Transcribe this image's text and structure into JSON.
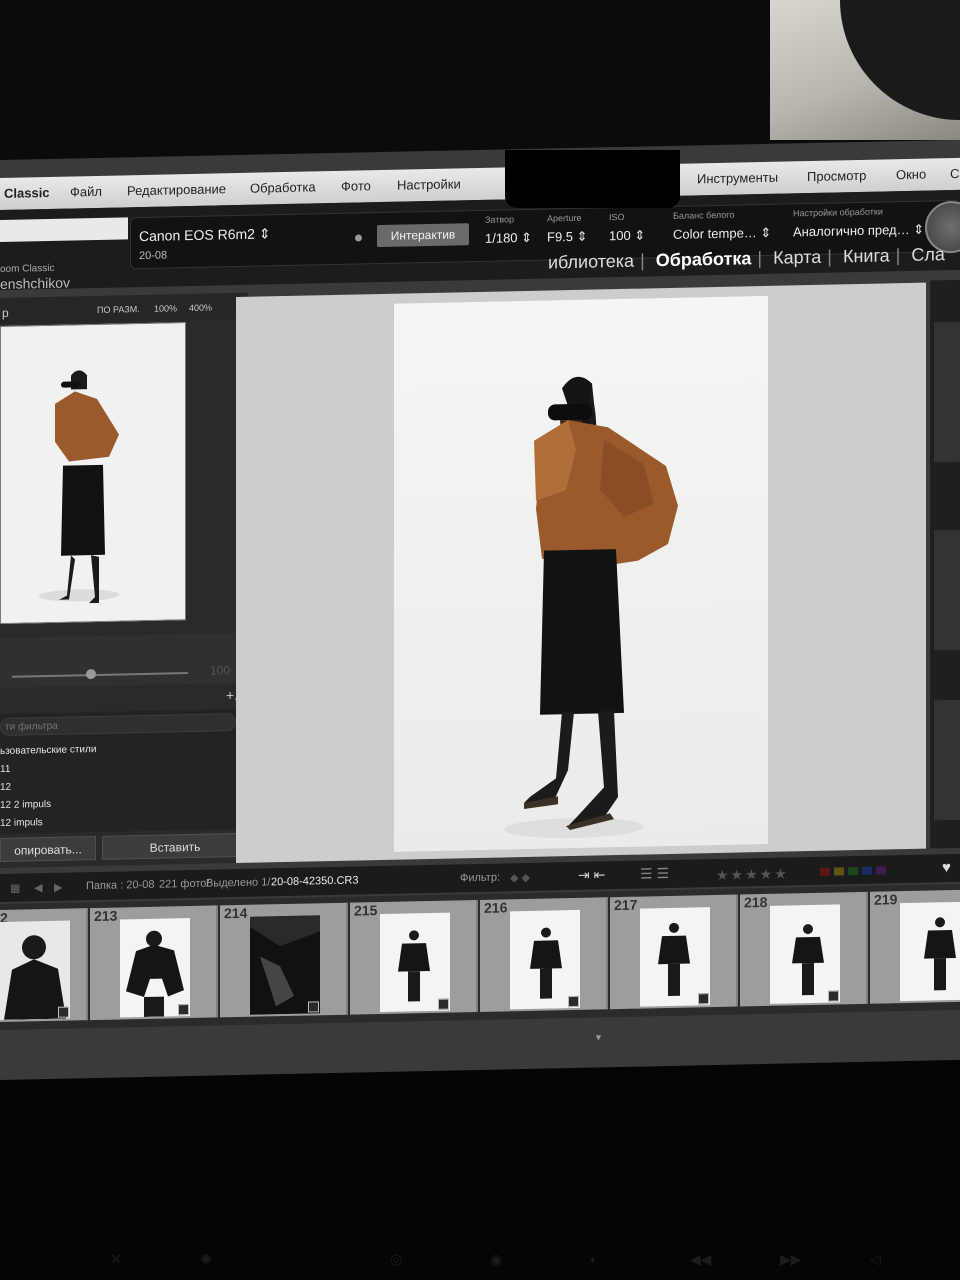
{
  "menubar": {
    "app": "Classic",
    "items": [
      "Файл",
      "Редактирование",
      "Обработка",
      "Фото",
      "Настройки",
      "Инструменты",
      "Просмотр",
      "Окно",
      "С"
    ]
  },
  "identity": {
    "brand": "oom Classic",
    "user": "enshchikov"
  },
  "infobar": {
    "camera": "Canon EOS R6m2",
    "folder": "20-08",
    "mode_button": "Интерактив",
    "shutter": {
      "label": "Затвор",
      "value": "1/180"
    },
    "aperture": {
      "label": "Aperture",
      "value": "F9.5"
    },
    "iso": {
      "label": "ISO",
      "value": "100"
    },
    "white_balance": {
      "label": "Баланс белого",
      "value": "Color tempe…"
    },
    "processing": {
      "label": "Настройки обработки",
      "value": "Аналогично пред…"
    }
  },
  "modules": [
    {
      "label": "иблиотека",
      "active": false
    },
    {
      "label": "Обработка",
      "active": true
    },
    {
      "label": "Карта",
      "active": false
    },
    {
      "label": "Книга",
      "active": false
    },
    {
      "label": "Сла",
      "active": false
    }
  ],
  "navigator": {
    "title": "р",
    "zoom_options": [
      "ПО РАЗМ.",
      "100%",
      "400%"
    ],
    "slider_value": "100"
  },
  "presets": {
    "search_placeholder": "ти фильтра",
    "items": [
      "ьзовательские стили",
      "11",
      "12",
      "12  2 impuls",
      "12 impuls"
    ]
  },
  "left_buttons": {
    "copy": "опировать...",
    "paste": "Вставить"
  },
  "filterbar": {
    "folder": "Папка : 20-08",
    "count": "221 фото/",
    "selected": "Выделено 1/",
    "filename": "20-08-42350.CR3",
    "filter_label": "Фильтр:",
    "stars": "★★★★★"
  },
  "filmstrip": {
    "frames": [
      {
        "number": "2",
        "style": "dark-closeup"
      },
      {
        "number": "213",
        "style": "dark"
      },
      {
        "number": "214",
        "style": "detail"
      },
      {
        "number": "215",
        "style": "full"
      },
      {
        "number": "216",
        "style": "full"
      },
      {
        "number": "217",
        "style": "full"
      },
      {
        "number": "218",
        "style": "full"
      },
      {
        "number": "219",
        "style": "full"
      }
    ]
  },
  "colors": {
    "jacket": "#9a5a2c",
    "label_red": "#8b1d1d",
    "label_yellow": "#8a7d18",
    "label_green": "#1f6b2a",
    "label_blue": "#1f3f8a",
    "label_purple": "#5a2a7a"
  }
}
